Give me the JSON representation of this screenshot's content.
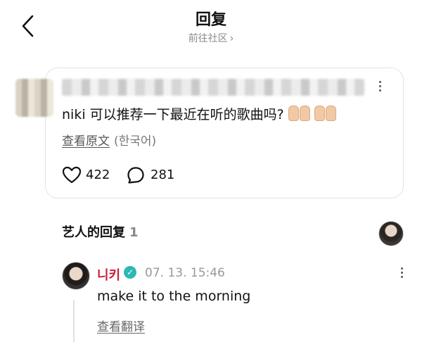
{
  "header": {
    "title": "回复",
    "subtitle": "前往社区",
    "subtitle_chevron": "›"
  },
  "post": {
    "text": "niki 可以推荐一下最近在听的歌曲吗?",
    "emoji": "palms-up-hands",
    "see_original": "查看原文",
    "language": "(한국어)",
    "likes": "422",
    "comments": "281"
  },
  "artist_section": {
    "title": "艺人的回复",
    "count": "1"
  },
  "reply": {
    "name": "니키",
    "timestamp": "07. 13. 15:46",
    "text": "make it to the morning",
    "translate": "查看翻译"
  },
  "icons": {
    "back": "back-arrow-icon",
    "like": "heart-icon",
    "comment": "comment-bubble-icon",
    "more": "more-vertical-icon",
    "verified": "verified-check-icon"
  },
  "colors": {
    "artist_name": "#c81e3c",
    "verified": "#2cb8b3",
    "muted": "#999999"
  }
}
